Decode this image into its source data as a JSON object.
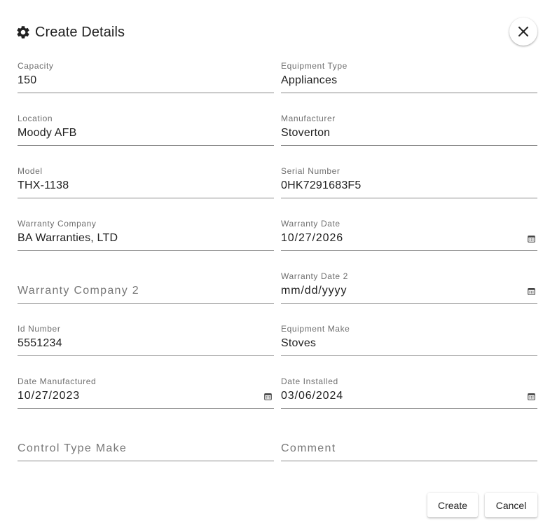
{
  "dialog": {
    "title": "Create Details",
    "title_icon": "gear-icon",
    "close_icon": "close-icon"
  },
  "fields": {
    "capacity": {
      "label": "Capacity",
      "value": "150"
    },
    "equipment_type": {
      "label": "Equipment Type",
      "value": "Appliances"
    },
    "location": {
      "label": "Location",
      "value": "Moody AFB"
    },
    "manufacturer": {
      "label": "Manufacturer",
      "value": "Stoverton"
    },
    "model": {
      "label": "Model",
      "value": "THX-1138"
    },
    "serial_number": {
      "label": "Serial Number",
      "value": "0HK7291683F5"
    },
    "warranty_company": {
      "label": "Warranty Company",
      "value": "BA Warranties, LTD"
    },
    "warranty_date": {
      "label": "Warranty Date",
      "value": "10/27/2026"
    },
    "warranty_company_2": {
      "placeholder": "Warranty Company 2"
    },
    "warranty_date_2": {
      "label": "Warranty Date 2",
      "placeholder": "mm/dd/yyyy"
    },
    "id_number": {
      "label": "Id Number",
      "value": "5551234"
    },
    "equipment_make": {
      "label": "Equipment Make",
      "value": "Stoves"
    },
    "date_manufactured": {
      "label": "Date Manufactured",
      "value": "10/27/2023"
    },
    "date_installed": {
      "label": "Date Installed",
      "value": "03/06/2024"
    },
    "control_type_make": {
      "placeholder": "Control Type Make"
    },
    "comment": {
      "placeholder": "Comment"
    }
  },
  "actions": {
    "create_label": "Create",
    "cancel_label": "Cancel"
  },
  "colors": {
    "text": "#212121",
    "label": "#6f6f6f",
    "underline": "#8a8a8a",
    "background": "#ffffff"
  }
}
